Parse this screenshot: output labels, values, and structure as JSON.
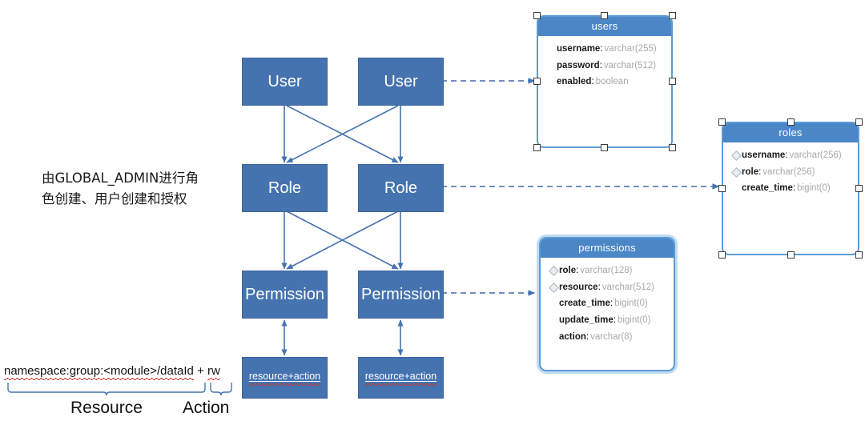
{
  "diagram": {
    "title": "RBAC permission model diagram",
    "colors": {
      "box_fill": "#4573B0",
      "box_border": "#3C649B",
      "table_header": "#4B87C7",
      "table_border": "#5B9BD5",
      "arrow": "#4573B0",
      "dashed_arrow": "#5B7FB5",
      "spellcheck_underline": "#d0342c",
      "brace": "#4573B0"
    }
  },
  "note": {
    "line1": "由GLOBAL_ADMIN进行角",
    "line2": "色创建、用户创建和授权"
  },
  "boxes": {
    "user_left": "User",
    "user_right": "User",
    "role_left": "Role",
    "role_right": "Role",
    "permission_left": "Permission",
    "permission_right": "Permission",
    "resource_action_left": "resource+action",
    "resource_action_right": "resource+action"
  },
  "legend": {
    "expr_resource": "namespace:group:<module>/dataId",
    "expr_plus": " + ",
    "expr_action": "rw",
    "label_resource": "Resource",
    "label_action": "Action"
  },
  "tables": [
    {
      "name": "users",
      "selected": true,
      "glow": false,
      "columns": [
        {
          "key": false,
          "name": "username",
          "type": "varchar(255)"
        },
        {
          "key": false,
          "name": "password",
          "type": "varchar(512)"
        },
        {
          "key": false,
          "name": "enabled",
          "type": "boolean"
        }
      ]
    },
    {
      "name": "roles",
      "selected": true,
      "glow": false,
      "columns": [
        {
          "key": true,
          "name": "username",
          "type": "varchar(256)"
        },
        {
          "key": true,
          "name": "role",
          "type": "varchar(256)"
        },
        {
          "key": false,
          "name": "create_time",
          "type": "bigint(0)"
        }
      ]
    },
    {
      "name": "permissions",
      "selected": false,
      "glow": true,
      "columns": [
        {
          "key": true,
          "name": "role",
          "type": "varchar(128)"
        },
        {
          "key": true,
          "name": "resource",
          "type": "varchar(512)"
        },
        {
          "key": false,
          "name": "create_time",
          "type": "bigint(0)"
        },
        {
          "key": false,
          "name": "update_time",
          "type": "bigint(0)"
        },
        {
          "key": false,
          "name": "action",
          "type": "varchar(8)"
        }
      ]
    }
  ]
}
